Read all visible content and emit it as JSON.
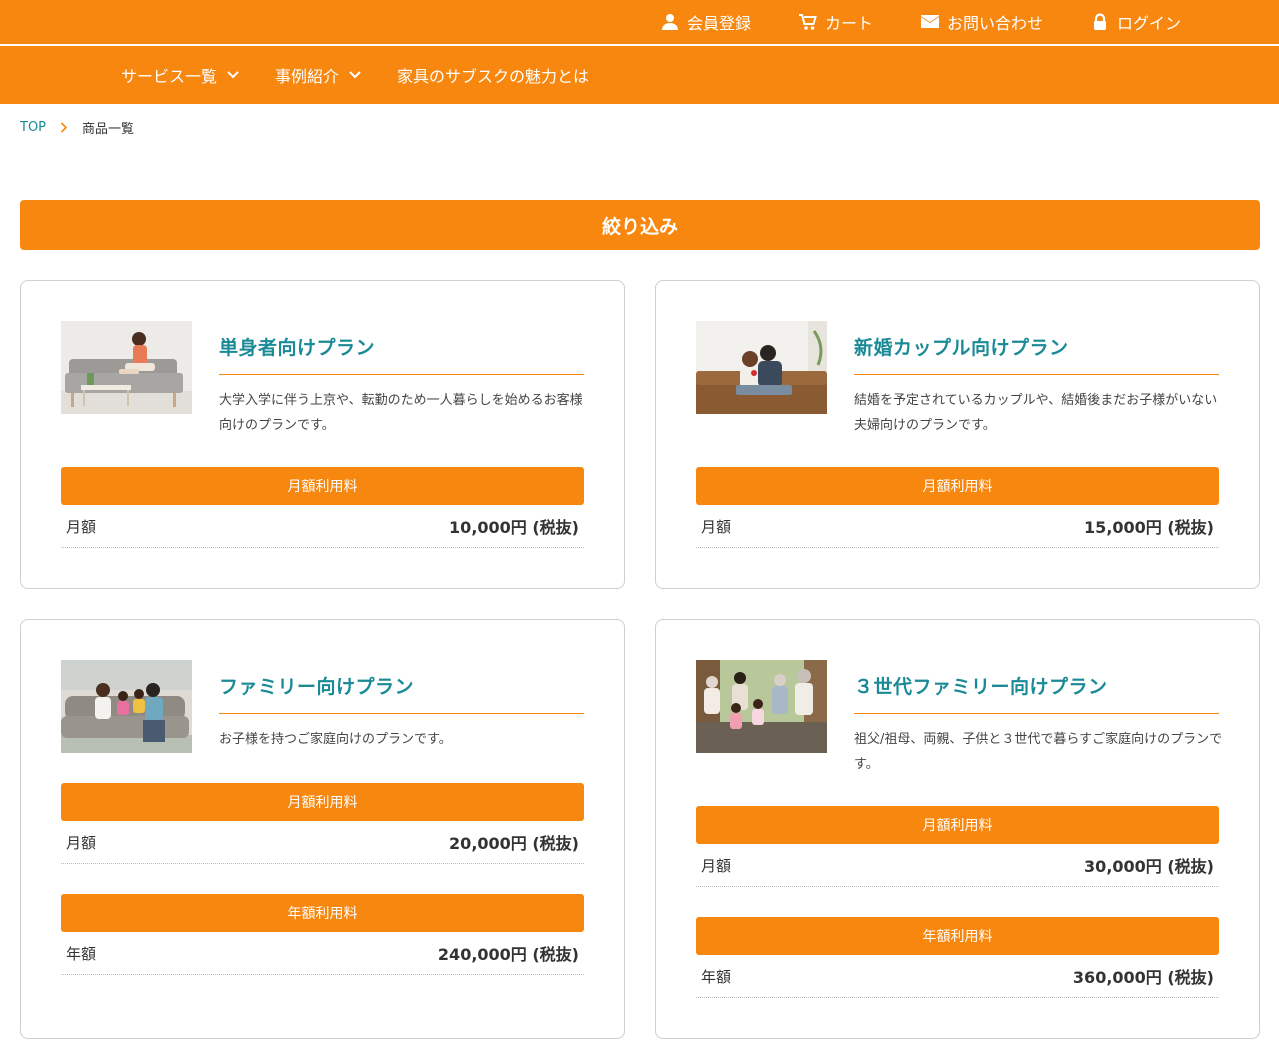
{
  "header": {
    "links": [
      {
        "label": "会員登録",
        "icon": "user-icon"
      },
      {
        "label": "カート",
        "icon": "cart-icon"
      },
      {
        "label": "お問い合わせ",
        "icon": "mail-icon"
      },
      {
        "label": "ログイン",
        "icon": "lock-icon"
      }
    ]
  },
  "nav": {
    "items": [
      {
        "label": "サービス一覧",
        "has_dropdown": true
      },
      {
        "label": "事例紹介",
        "has_dropdown": true
      },
      {
        "label": "家具のサブスクの魅力とは",
        "has_dropdown": false
      }
    ]
  },
  "breadcrumb": {
    "home": "TOP",
    "current": "商品一覧"
  },
  "filter": {
    "label": "絞り込み"
  },
  "colors": {
    "accent": "#f7870f",
    "title": "#1a8a96",
    "border": "#cfcfcf"
  },
  "products": [
    {
      "title": "単身者向けプラン",
      "description": "大学入学に伴う上京や、転勤のため一人暮らしを始めるお客様向けのプランです。",
      "image": "single-person-sofa-photo",
      "monthly": {
        "header": "月額利用料",
        "label": "月額",
        "price": "10,000円 (税抜)"
      }
    },
    {
      "title": "新婚カップル向けプラン",
      "description": "結婚を予定されているカップルや、結婚後まだお子様がいない夫婦向けのプランです。",
      "image": "couple-sofa-photo",
      "monthly": {
        "header": "月額利用料",
        "label": "月額",
        "price": "15,000円 (税抜)"
      }
    },
    {
      "title": "ファミリー向けプラン",
      "description": "お子様を持つご家庭向けのプランです。",
      "image": "family-sofa-photo",
      "monthly": {
        "header": "月額利用料",
        "label": "月額",
        "price": "20,000円 (税抜)"
      },
      "yearly": {
        "header": "年額利用料",
        "label": "年額",
        "price": "240,000円 (税抜)"
      }
    },
    {
      "title": "３世代ファミリー向けプラン",
      "description": "祖父/祖母、両親、子供と３世代で暮らすご家庭向けのプランです。",
      "image": "three-generation-family-photo",
      "monthly": {
        "header": "月額利用料",
        "label": "月額",
        "price": "30,000円 (税抜)"
      },
      "yearly": {
        "header": "年額利用料",
        "label": "年額",
        "price": "360,000円 (税抜)"
      }
    }
  ]
}
